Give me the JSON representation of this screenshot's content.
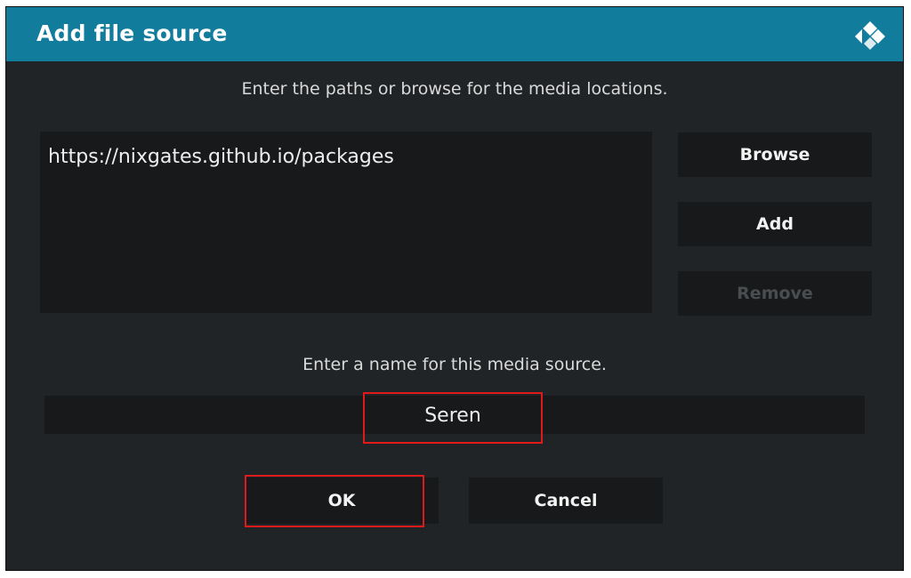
{
  "dialog": {
    "title": "Add file source",
    "logo_icon": "kodi-logo-icon",
    "paths_instruction": "Enter the paths or browse for the media locations.",
    "paths": [
      "https://nixgates.github.io/packages"
    ],
    "buttons": {
      "browse": "Browse",
      "add": "Add",
      "remove": "Remove"
    },
    "name_instruction": "Enter a name for this media source.",
    "name_value": "Seren",
    "ok_label": "OK",
    "cancel_label": "Cancel"
  },
  "colors": {
    "title_bar": "#127c9c",
    "dialog_bg": "#212426",
    "field_bg": "#17191a",
    "highlight_border": "#e01a1a",
    "disabled_text": "#4a4d4f"
  }
}
